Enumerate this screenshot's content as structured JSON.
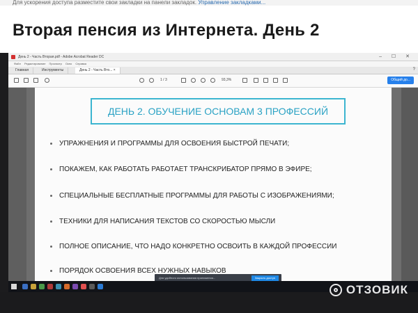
{
  "topnote": {
    "text": "Для ускорения доступа разместите свои закладки на панели закладок.",
    "link": "Управление закладками..."
  },
  "page_title": "Вторая пенсия из Интернета. День 2",
  "acrobat": {
    "window_title": "День 2 - Часть Вторая.pdf - Adobe Acrobat Reader DC",
    "window_controls": "– ☐ ✕",
    "menu": "Файл Редактирование Просмотр Окно Справка",
    "tabs": [
      {
        "label": "Главная"
      },
      {
        "label": "Инструменты"
      },
      {
        "label": "День 2 - Часть Вто... ×"
      }
    ],
    "tabs_right": "?",
    "toolbar": {
      "page_indicator": "1 / 3",
      "zoom": "93,3%",
      "share_label": "Общий до..."
    },
    "heading": "ДЕНЬ 2. ОБУЧЕНИЕ ОСНОВАМ 3 ПРОФЕССИЙ",
    "bullets": [
      "УПРАЖНЕНИЯ И ПРОГРАММЫ ДЛЯ ОСВОЕНИЯ БЫСТРОЙ ПЕЧАТИ;",
      "ПОКАЖЕМ, КАК РАБОТАТЬ РАБОТАЕТ ТРАНСКРИБАТОР ПРЯМО В ЭФИРЕ;",
      "СПЕЦИАЛЬНЫЕ БЕСПЛАТНЫЕ ПРОГРАММЫ ДЛЯ РАБОТЫ С ИЗОБРАЖЕНИЯМИ;",
      "ТЕХНИКИ ДЛЯ НАПИСАНИЯ ТЕКСТОВ СО СКОРОСТЬЮ МЫСЛИ",
      "ПОЛНОЕ ОПИСАНИЕ, ЧТО НАДО КОНКРЕТНО ОСВОИТЬ В КАЖДОЙ ПРОФЕССИИ",
      "ПОРЯДОК ОСВОЕНИЯ ВСЕХ НУЖНЫХ НАВЫКОВ"
    ],
    "notification": {
      "text": "Для удобного использования приложения...",
      "button": "Закрыть доступ"
    }
  },
  "watermark": "ОТЗОВИК",
  "colors": {
    "heading_accent": "#3bb5d0",
    "share_button": "#2680eb",
    "taskbar": "#111318"
  }
}
